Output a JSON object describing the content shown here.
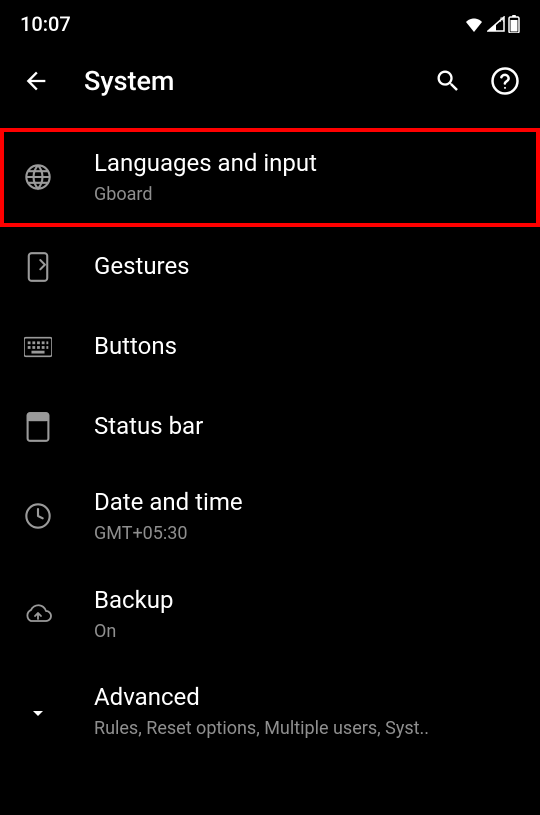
{
  "status_bar": {
    "time": "10:07"
  },
  "app_bar": {
    "title": "System"
  },
  "items": [
    {
      "title": "Languages and input",
      "subtitle": "Gboard"
    },
    {
      "title": "Gestures",
      "subtitle": null
    },
    {
      "title": "Buttons",
      "subtitle": null
    },
    {
      "title": "Status bar",
      "subtitle": null
    },
    {
      "title": "Date and time",
      "subtitle": "GMT+05:30"
    },
    {
      "title": "Backup",
      "subtitle": "On"
    },
    {
      "title": "Advanced",
      "subtitle": "Rules, Reset options, Multiple users, Syst.."
    }
  ]
}
